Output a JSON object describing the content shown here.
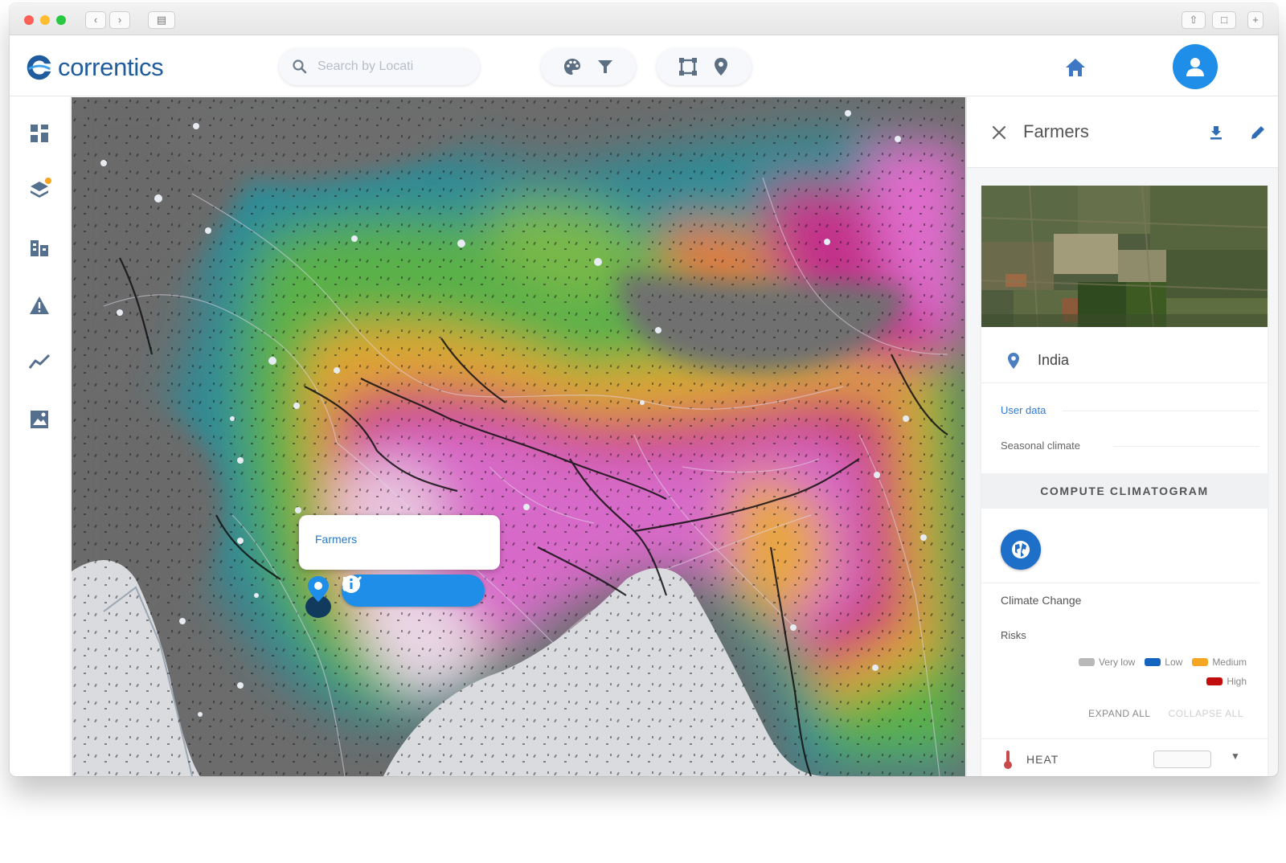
{
  "header": {
    "brand": "correntics",
    "search_placeholder": "Search by Locati"
  },
  "popup": {
    "title": "Farmers"
  },
  "panel": {
    "title": "Farmers",
    "location": "India",
    "user_data_link": "User data",
    "seasonal_climate_label": "Seasonal climate",
    "compute_button": "COMPUTE CLIMATOGRAM",
    "climate_change_label": "Climate Change",
    "risks_label": "Risks",
    "legend": [
      {
        "label": "Very low",
        "color": "#b9b9b9"
      },
      {
        "label": "Low",
        "color": "#1565c0"
      },
      {
        "label": "Medium",
        "color": "#f5a623"
      },
      {
        "label": "High",
        "color": "#c10d0d"
      }
    ],
    "expand_all": "EXPAND ALL",
    "collapse_all": "COLLAPSE ALL",
    "heat_label": "HEAT"
  },
  "colors": {
    "brand_blue": "#1f5c9e",
    "accent_blue": "#1e8ee8"
  }
}
